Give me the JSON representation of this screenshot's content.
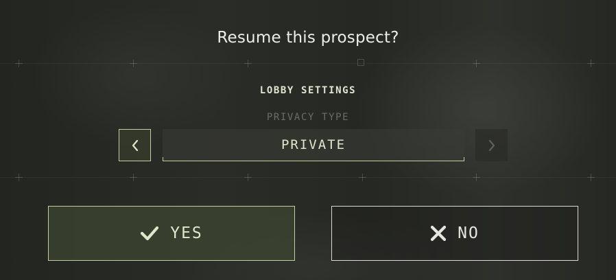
{
  "dialog": {
    "title": "Resume this prospect?",
    "section_label": "LOBBY SETTINGS",
    "privacy": {
      "label": "PRIVACY TYPE",
      "value": "PRIVATE",
      "prev_icon": "chevron-left-icon",
      "next_icon": "chevron-right-icon"
    },
    "yes": {
      "label": "YES",
      "icon": "checkmark-icon"
    },
    "no": {
      "label": "NO",
      "icon": "close-icon"
    }
  },
  "colors": {
    "accent": "#c3d1a2",
    "accent_text": "#dfe8cb",
    "title_text": "#eceee8",
    "muted_text": "#6b6e66",
    "background": "#262823"
  }
}
